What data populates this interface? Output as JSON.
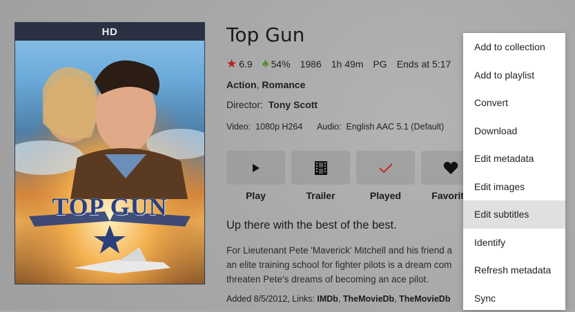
{
  "poster": {
    "badge": "HD",
    "logo_text": "TOP GUN"
  },
  "movie": {
    "title": "Top Gun",
    "rating": "6.9",
    "audience_score": "54%",
    "year": "1986",
    "runtime": "1h 49m",
    "certification": "PG",
    "ends_at": "Ends at 5:17",
    "genres": [
      "Action",
      "Romance"
    ],
    "genre_separator": ", ",
    "director_label": "Director:",
    "director": "Tony Scott",
    "video_label": "Video:",
    "video_value": "1080p H264",
    "audio_label": "Audio:",
    "audio_value": "English AAC 5.1 (Default)",
    "tagline": "Up there with the best of the best.",
    "overview_lines": [
      "For Lieutenant Pete 'Maverick' Mitchell and his friend a",
      "an elite training school for fighter pilots is a dream com",
      "threaten Pete's dreams of becoming an ace pilot."
    ],
    "added_text": "Added 8/5/2012, Links: ",
    "links": [
      "IMDb",
      "TheMovieDb",
      "TheMovieDb"
    ]
  },
  "actions": [
    {
      "label": "Play",
      "icon": "play-icon"
    },
    {
      "label": "Trailer",
      "icon": "film-icon"
    },
    {
      "label": "Played",
      "icon": "check-icon"
    },
    {
      "label": "Favorite",
      "icon": "heart-icon"
    }
  ],
  "context_menu": {
    "items": [
      "Add to collection",
      "Add to playlist",
      "Convert",
      "Download",
      "Edit metadata",
      "Edit images",
      "Edit subtitles",
      "Identify",
      "Refresh metadata",
      "Sync"
    ],
    "highlighted": "Edit subtitles"
  },
  "colors": {
    "star": "#b71c1c",
    "clover": "#5a8a2a",
    "check": "#c62828",
    "menu_bg": "#ffffff",
    "menu_hover": "#e0e0e0"
  }
}
